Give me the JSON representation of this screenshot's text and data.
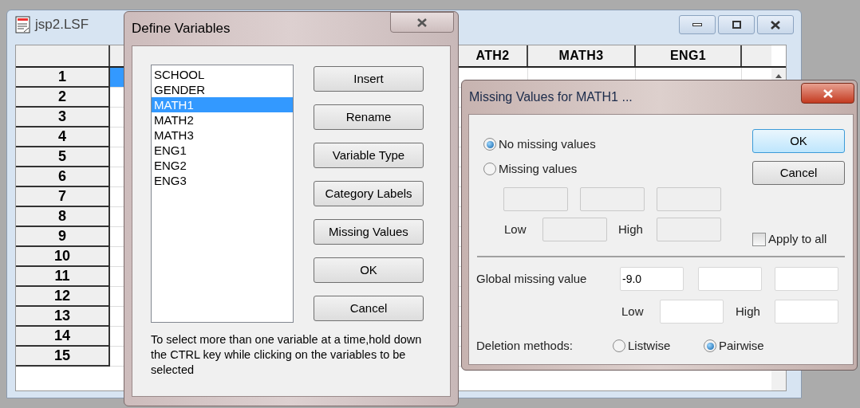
{
  "main_window": {
    "title": "jsp2.LSF",
    "column_headers": [
      "ATH2",
      "MATH3",
      "ENG1"
    ],
    "rows": [
      {
        "number": "1",
        "selected": true
      },
      {
        "number": "2",
        "selected": false
      },
      {
        "number": "3",
        "selected": false
      },
      {
        "number": "4",
        "selected": false
      },
      {
        "number": "5",
        "selected": false
      },
      {
        "number": "6",
        "selected": false
      },
      {
        "number": "7",
        "selected": false
      },
      {
        "number": "8",
        "selected": false
      },
      {
        "number": "9",
        "selected": false
      },
      {
        "number": "10",
        "selected": false
      },
      {
        "number": "11",
        "selected": false
      },
      {
        "number": "12",
        "selected": false
      },
      {
        "number": "13",
        "selected": false
      },
      {
        "number": "14",
        "selected": false
      },
      {
        "number": "15",
        "selected": false
      }
    ]
  },
  "define_dialog": {
    "title": "Define Variables",
    "variables": [
      {
        "name": "SCHOOL",
        "selected": false
      },
      {
        "name": "GENDER",
        "selected": false
      },
      {
        "name": "MATH1",
        "selected": true
      },
      {
        "name": "MATH2",
        "selected": false
      },
      {
        "name": "MATH3",
        "selected": false
      },
      {
        "name": "ENG1",
        "selected": false
      },
      {
        "name": "ENG2",
        "selected": false
      },
      {
        "name": "ENG3",
        "selected": false
      }
    ],
    "buttons": [
      "Insert",
      "Rename",
      "Variable Type",
      "Category Labels",
      "Missing Values",
      "OK",
      "Cancel"
    ],
    "hint": "To select more than one variable at a time,hold down the CTRL key while clicking on the variables to be selected"
  },
  "missing_dialog": {
    "title": "Missing Values for MATH1 ...",
    "options": [
      {
        "label": "No missing values",
        "selected": true
      },
      {
        "label": "Missing values",
        "selected": false
      }
    ],
    "value_fields_disabled": true,
    "low_label": "Low",
    "high_label": "High",
    "ok": "OK",
    "cancel": "Cancel",
    "apply_to_all": {
      "label": "Apply to all",
      "checked": false
    },
    "global": {
      "label": "Global missing value",
      "value": "-9.0",
      "low_label": "Low",
      "high_label": "High"
    },
    "deletion": {
      "label": "Deletion methods:",
      "options": [
        {
          "label": "Listwise",
          "selected": false
        },
        {
          "label": "Pairwise",
          "selected": true
        }
      ]
    }
  }
}
